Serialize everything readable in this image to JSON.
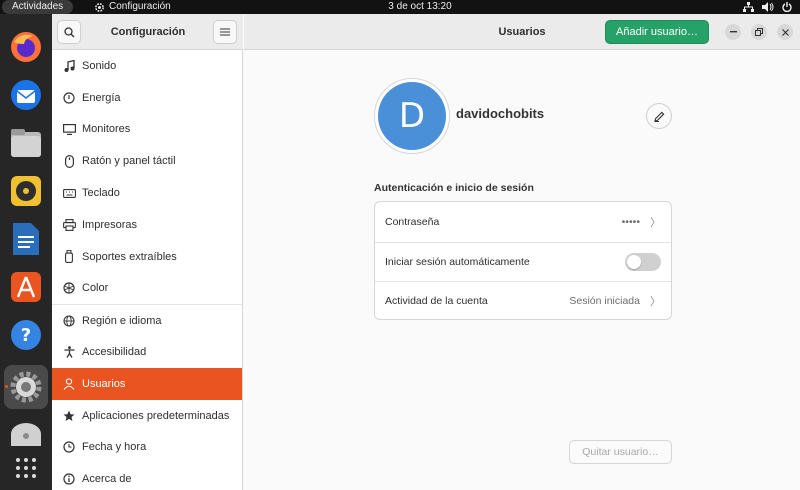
{
  "topbar": {
    "activities": "Actividades",
    "app_name": "Configuración",
    "clock": "3 de oct  13:20"
  },
  "dock": {
    "items": [
      {
        "name": "firefox-icon"
      },
      {
        "name": "thunderbird-icon"
      },
      {
        "name": "files-icon"
      },
      {
        "name": "rhythmbox-icon"
      },
      {
        "name": "writer-icon"
      },
      {
        "name": "software-icon"
      },
      {
        "name": "help-icon"
      },
      {
        "name": "settings-icon",
        "active": true
      },
      {
        "name": "disc-icon"
      },
      {
        "name": "app-grid-icon"
      }
    ]
  },
  "sidebar": {
    "title": "Configuración",
    "items": [
      {
        "label": "Sonido",
        "icon": "music-note-icon"
      },
      {
        "label": "Energía",
        "icon": "power-icon"
      },
      {
        "label": "Monitores",
        "icon": "monitor-icon"
      },
      {
        "label": "Ratón y panel táctil",
        "icon": "mouse-icon"
      },
      {
        "label": "Teclado",
        "icon": "keyboard-icon"
      },
      {
        "label": "Impresoras",
        "icon": "printer-icon"
      },
      {
        "label": "Soportes extraíbles",
        "icon": "usb-icon"
      },
      {
        "label": "Color",
        "icon": "color-icon"
      },
      {
        "label": "Región e idioma",
        "icon": "globe-icon"
      },
      {
        "label": "Accesibilidad",
        "icon": "accessibility-icon"
      },
      {
        "label": "Usuarios",
        "icon": "users-icon",
        "active": true
      },
      {
        "label": "Aplicaciones predeterminadas",
        "icon": "star-icon"
      },
      {
        "label": "Fecha y hora",
        "icon": "clock-icon"
      },
      {
        "label": "Acerca de",
        "icon": "info-icon"
      }
    ]
  },
  "main": {
    "title": "Usuarios",
    "add_user_label": "Añadir usuario…",
    "avatar_initial": "D",
    "username": "davidochobits",
    "section_title": "Autenticación e inicio de sesión",
    "rows": {
      "password_label": "Contraseña",
      "password_value": "•••••",
      "autologin_label": "Iniciar sesión automáticamente",
      "autologin_enabled": false,
      "activity_label": "Actividad de la cuenta",
      "activity_value": "Sesión iniciada"
    },
    "remove_user_label": "Quitar usuario…"
  },
  "colors": {
    "accent": "#e95420",
    "add_button": "#26a269",
    "avatar": "#4a90d9"
  }
}
